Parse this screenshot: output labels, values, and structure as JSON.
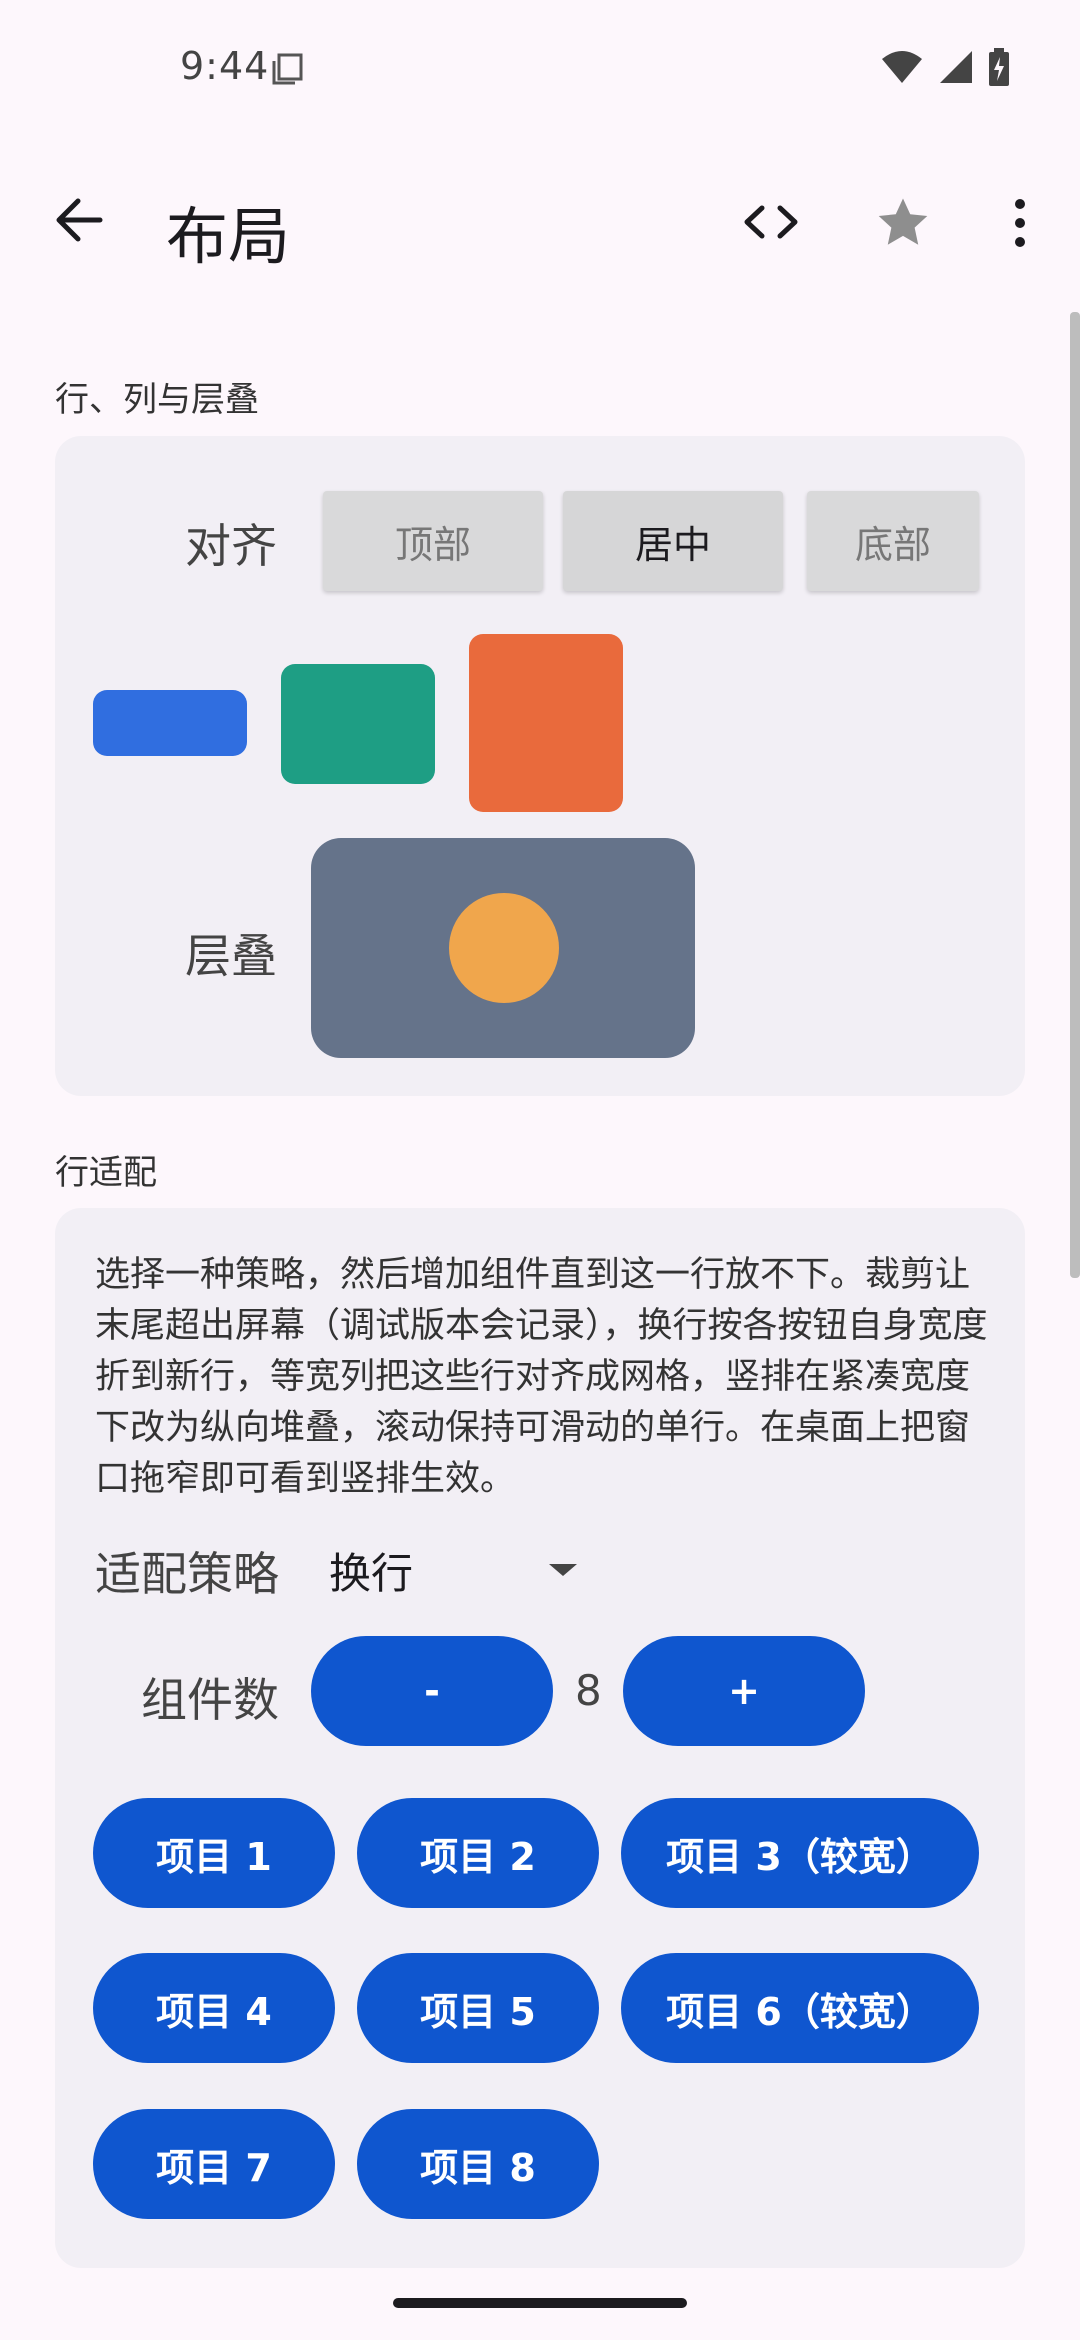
{
  "status": {
    "time": "9:44"
  },
  "appbar": {
    "title": "布局"
  },
  "sections": {
    "rows": {
      "label": "行、列与层叠",
      "align_label": "对齐",
      "align_options": [
        "顶部",
        "居中",
        "底部"
      ],
      "selected_align": "居中",
      "stack_label": "层叠",
      "colors": {
        "blue": "#306EE0",
        "green": "#1E9E84",
        "orange": "#E96A3C",
        "stack_bg": "#65738A",
        "circle": "#F0A64C"
      }
    },
    "fit": {
      "label": "行适配",
      "description": "选择一种策略，然后增加组件直到这一行放不下。裁剪让末尾超出屏幕（调试版本会记录），换行按各按钮自身宽度折到新行，等宽列把这些行对齐成网格，竖排在紧凑宽度下改为纵向堆叠，滚动保持可滑动的单行。在桌面上把窗口拖窄即可看到竖排生效。",
      "strategy_label": "适配策略",
      "strategy_value": "换行",
      "count_label": "组件数",
      "count_value": "8",
      "minus_label": "-",
      "plus_label": "+",
      "items": [
        "项目 1",
        "项目 2",
        "项目 3（较宽）",
        "项目 4",
        "项目 5",
        "项目 6（较宽）",
        "项目 7",
        "项目 8"
      ]
    }
  },
  "accent_color": "#0F56CF"
}
